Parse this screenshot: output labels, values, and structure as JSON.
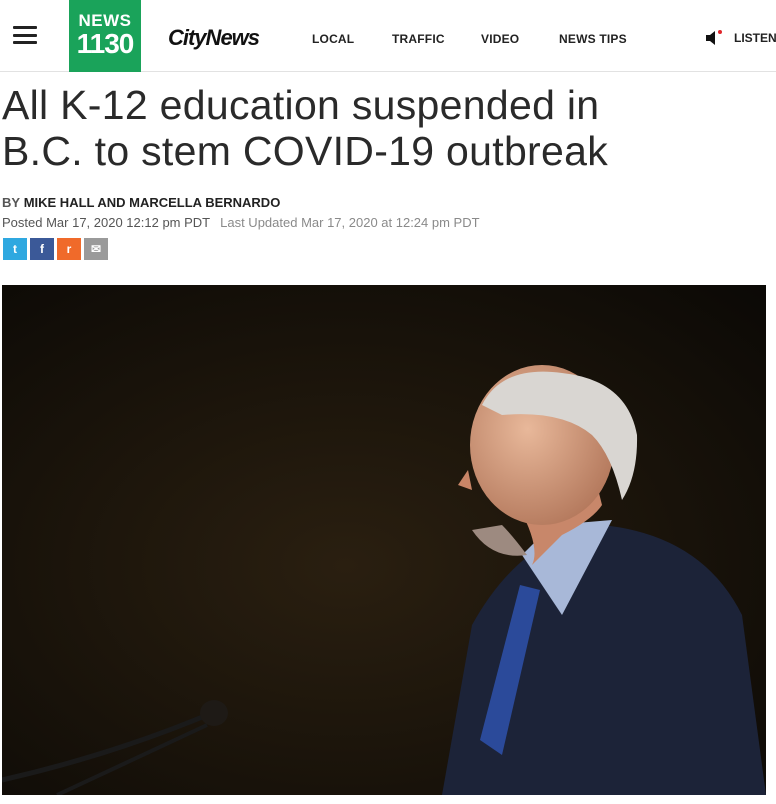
{
  "header": {
    "logo_line1": "NEWS",
    "logo_line2": "1130",
    "brand": "CityNews",
    "nav": [
      "LOCAL",
      "TRAFFIC",
      "VIDEO",
      "NEWS TIPS"
    ],
    "listen_label": "LISTEN",
    "colors": {
      "logo_green": "#1aa35a"
    }
  },
  "article": {
    "headline_line1": "All K-12 education suspended in",
    "headline_line2": "B.C. to stem COVID-19 outbreak",
    "byline_prefix": "BY",
    "byline_names": "MIKE HALL AND MARCELLA BERNARDO",
    "posted": "Posted Mar 17, 2020 12:12 pm PDT",
    "updated": "Last Updated Mar 17, 2020 at 12:24 pm PDT"
  },
  "share": [
    {
      "icon": "twitter-icon",
      "glyph": "t",
      "color": "#2fa8e0"
    },
    {
      "icon": "facebook-icon",
      "glyph": "f",
      "color": "#3b5998"
    },
    {
      "icon": "reddit-icon",
      "glyph": "r",
      "color": "#f06a2a"
    },
    {
      "icon": "email-icon",
      "glyph": "✉",
      "color": "#9a9a9a"
    }
  ]
}
